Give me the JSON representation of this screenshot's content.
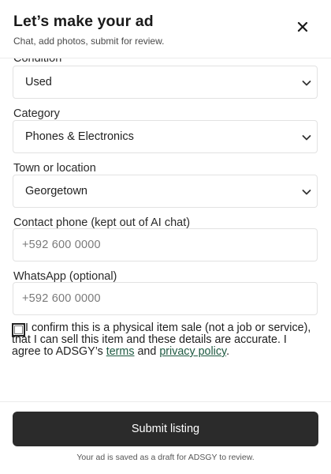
{
  "header": {
    "title": "Let’s make your ad",
    "subtitle": "Chat, add photos, submit for review."
  },
  "form": {
    "condition": {
      "label": "Condition",
      "value": "Used"
    },
    "category": {
      "label": "Category",
      "value": "Phones & Electronics"
    },
    "location": {
      "label": "Town or location",
      "value": "Georgetown"
    },
    "phone": {
      "label": "Contact phone (kept out of AI chat)",
      "placeholder": "+592 600 0000"
    },
    "whatsapp": {
      "label": "WhatsApp (optional)",
      "placeholder": "+592 600 0000"
    },
    "consent": {
      "text_before": "I confirm this is a physical item sale (not a job or service), that I can sell this item and these details are accurate. I agree to ADSGY’s ",
      "terms_link": "terms",
      "and_text": " and ",
      "privacy_link": "privacy policy",
      "text_after": "."
    }
  },
  "footer": {
    "submit_label": "Submit listing",
    "draft_note": "Your ad is saved as a draft for ADSGY to review."
  },
  "icons": {
    "close": "close-icon",
    "chevron": "chevron-down-icon"
  }
}
